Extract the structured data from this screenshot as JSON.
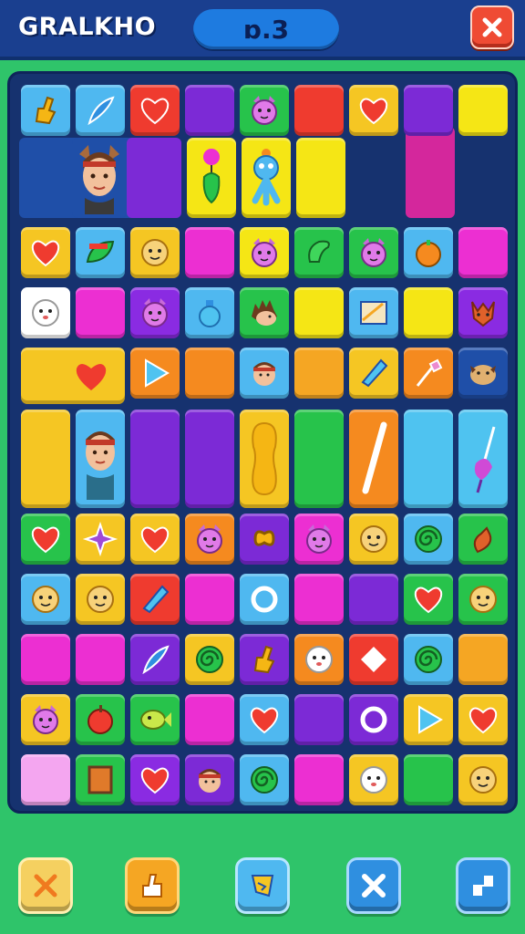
{
  "header": {
    "title": "GRALKHO",
    "score": "ɒ.3",
    "close_icon": "close-icon"
  },
  "colors": {
    "background": "#2fc46a",
    "topbar": "#1a3f8f",
    "board": "#16326f",
    "score_pill": "#1e7be0",
    "close_button": "#ef4b34"
  },
  "board": {
    "columns": 9,
    "rows": 11,
    "tiles": [
      [
        {
          "color": "#4fb8f0",
          "icon": "hand-icon"
        },
        {
          "color": "#4fb8f0",
          "icon": "feather-icon"
        },
        {
          "color": "#ef3b2f",
          "icon": "heart-icon"
        },
        {
          "color": "#7c2ad6",
          "icon": ""
        },
        {
          "color": "#27c34b",
          "icon": "cat-face-icon"
        },
        {
          "color": "#ef3b2f",
          "icon": ""
        },
        {
          "color": "#f5c623",
          "icon": "heart-icon"
        },
        {
          "color": "#7c2ad6",
          "icon": ""
        },
        {
          "color": "#f5e615",
          "icon": ""
        }
      ],
      [
        {
          "color": "#f5c623",
          "icon": "heart-icon"
        },
        {
          "color": "#4fb8f0",
          "icon": "leaf-icon"
        },
        {
          "color": "#f5c623",
          "icon": "face-icon"
        },
        {
          "color": "#ec2fd2",
          "icon": ""
        },
        {
          "color": "#f5e615",
          "icon": "cat-face-icon"
        },
        {
          "color": "#27c34b",
          "icon": "pickle-icon"
        },
        {
          "color": "#27c34b",
          "icon": "cat-face-icon"
        },
        {
          "color": "#4fb8f0",
          "icon": "pumpkin-icon"
        },
        {
          "color": "#ec2fd2",
          "icon": ""
        }
      ],
      [
        {
          "color": "#ffffff",
          "icon": "ghost-icon"
        },
        {
          "color": "#ec2fd2",
          "icon": ""
        },
        {
          "color": "#8a2be2",
          "icon": "cat-face-icon"
        },
        {
          "color": "#4fb8f0",
          "icon": "bottle-icon"
        },
        {
          "color": "#27c34b",
          "icon": "hedgehog-icon"
        },
        {
          "color": "#f5e615",
          "icon": ""
        },
        {
          "color": "#4fb8f0",
          "icon": "picture-icon"
        },
        {
          "color": "#f5e615",
          "icon": ""
        },
        {
          "color": "#8a2be2",
          "icon": "fox-icon"
        }
      ],
      [
        {
          "color": "#f5c623",
          "icon": "heart-icon"
        },
        {
          "color": "#f5c623",
          "icon": ""
        },
        {
          "color": "#f58a1f",
          "icon": "arrow-icon"
        },
        {
          "color": "#f58a1f",
          "icon": ""
        },
        {
          "color": "#4fb8f0",
          "icon": "person-icon"
        },
        {
          "color": "#f5a623",
          "icon": ""
        },
        {
          "color": "#f5c623",
          "icon": "crystal-icon"
        },
        {
          "color": "#f58a1f",
          "icon": "brush-icon"
        },
        {
          "color": "#1f4fa8",
          "icon": "cow-icon"
        }
      ],
      [
        {
          "color": "#f5c623",
          "icon": ""
        },
        {
          "color": "#4fb8f0",
          "icon": "person-icon"
        },
        {
          "color": "#7c2ad6",
          "icon": ""
        },
        {
          "color": "#7c2ad6",
          "icon": ""
        },
        {
          "color": "#f5c623",
          "icon": "bean-icon"
        },
        {
          "color": "#27c34b",
          "icon": ""
        },
        {
          "color": "#f58a1f",
          "icon": "stick-icon"
        },
        {
          "color": "#4fc3f0",
          "icon": ""
        },
        {
          "color": "#4fc3f0",
          "icon": "spoon-icon"
        }
      ],
      [
        {
          "color": "#27c34b",
          "icon": "heart-icon"
        },
        {
          "color": "#f5c623",
          "icon": "star-icon"
        },
        {
          "color": "#f5c623",
          "icon": "heart-icon"
        },
        {
          "color": "#f58a1f",
          "icon": "cat-face-icon"
        },
        {
          "color": "#7c2ad6",
          "icon": "pretzel-icon"
        },
        {
          "color": "#ec2fd2",
          "icon": "cat-face-icon"
        },
        {
          "color": "#f5c623",
          "icon": "face-icon"
        },
        {
          "color": "#4fb8f0",
          "icon": "spiral-icon"
        },
        {
          "color": "#27c34b",
          "icon": "pepper-icon"
        }
      ],
      [
        {
          "color": "#4fb8f0",
          "icon": "face-icon"
        },
        {
          "color": "#f5c623",
          "icon": "face-icon"
        },
        {
          "color": "#ef3b2f",
          "icon": "crystal-icon"
        },
        {
          "color": "#ec2fd2",
          "icon": ""
        },
        {
          "color": "#4fb8f0",
          "icon": "ring-icon"
        },
        {
          "color": "#ec2fd2",
          "icon": ""
        },
        {
          "color": "#7c2ad6",
          "icon": ""
        },
        {
          "color": "#27c34b",
          "icon": "heart-icon"
        },
        {
          "color": "#27c34b",
          "icon": "face-icon"
        }
      ],
      [
        {
          "color": "#ec2fd2",
          "icon": ""
        },
        {
          "color": "#ec2fd2",
          "icon": ""
        },
        {
          "color": "#7c2ad6",
          "icon": "feather-icon"
        },
        {
          "color": "#f5c623",
          "icon": "spiral-icon"
        },
        {
          "color": "#7c2ad6",
          "icon": "hand-icon"
        },
        {
          "color": "#f58a1f",
          "icon": "ghost-icon"
        },
        {
          "color": "#ef3b2f",
          "icon": "diamond-icon"
        },
        {
          "color": "#4fb8f0",
          "icon": "spiral-icon"
        },
        {
          "color": "#f5a623",
          "icon": ""
        }
      ],
      [
        {
          "color": "#f5c623",
          "icon": "cat-face-icon"
        },
        {
          "color": "#27c34b",
          "icon": "apple-icon"
        },
        {
          "color": "#27c34b",
          "icon": "fish-icon"
        },
        {
          "color": "#ec2fd2",
          "icon": ""
        },
        {
          "color": "#4fb8f0",
          "icon": "heart-icon"
        },
        {
          "color": "#7c2ad6",
          "icon": ""
        },
        {
          "color": "#7c2ad6",
          "icon": "ring-icon"
        },
        {
          "color": "#f5c623",
          "icon": "arrow-icon"
        },
        {
          "color": "#f5c623",
          "icon": "heart-icon"
        }
      ],
      [
        {
          "color": "#f4a6f0",
          "icon": ""
        },
        {
          "color": "#27c34b",
          "icon": "frame-icon"
        },
        {
          "color": "#8a2be2",
          "icon": "heart-icon"
        },
        {
          "color": "#7c2ad6",
          "icon": "person-icon"
        },
        {
          "color": "#4fb8f0",
          "icon": "spiral-icon"
        },
        {
          "color": "#ec2fd2",
          "icon": ""
        },
        {
          "color": "#f5c623",
          "icon": "ghost-icon"
        },
        {
          "color": "#27c34b",
          "icon": ""
        },
        {
          "color": "#f5c623",
          "icon": "face-icon"
        }
      ]
    ]
  },
  "bottom_buttons": [
    {
      "name": "cancel-button",
      "icon": "x-icon",
      "color": "#f5d060"
    },
    {
      "name": "hand-button",
      "icon": "hand-icon",
      "color": "#f5a623"
    },
    {
      "name": "card-button",
      "icon": "card-icon",
      "color": "#4fb8f0"
    },
    {
      "name": "shuffle-button",
      "icon": "x-icon",
      "color": "#2f8fe0"
    },
    {
      "name": "corner-button",
      "icon": "corner-icon",
      "color": "#2f8fe0"
    }
  ]
}
